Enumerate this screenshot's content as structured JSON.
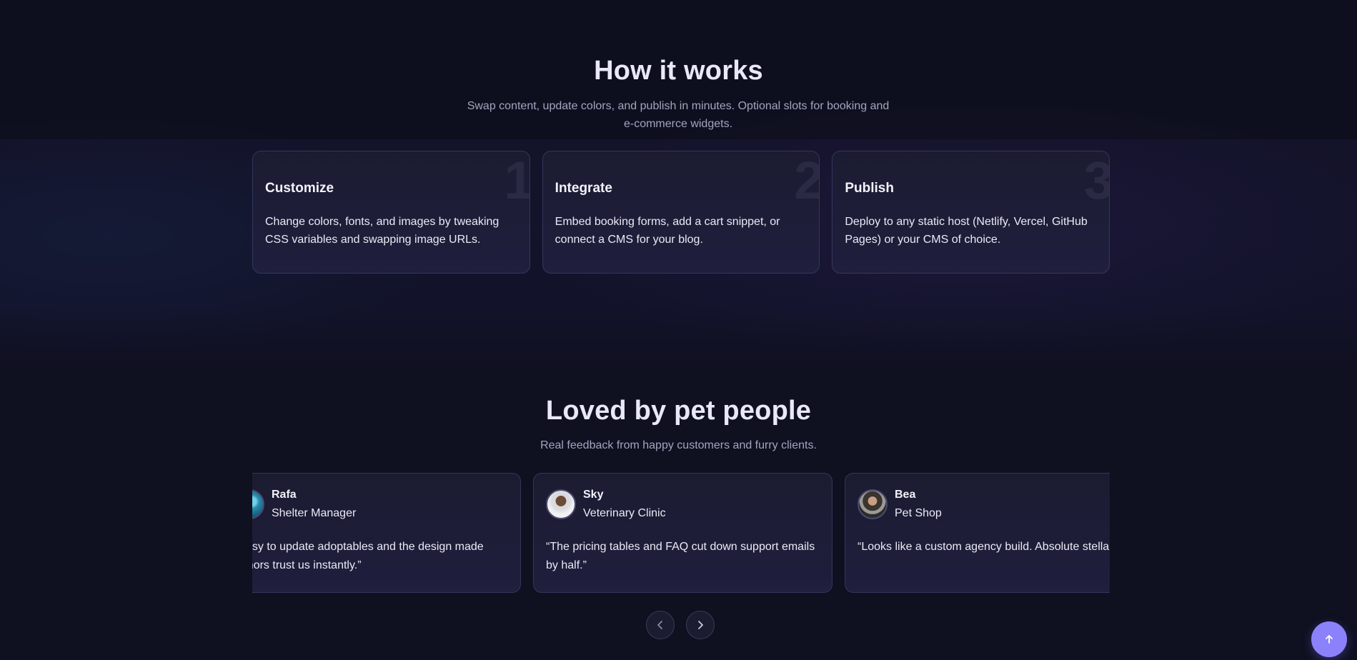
{
  "how_it_works": {
    "title": "How it works",
    "subtitle": "Swap content, update colors, and publish in minutes. Optional slots for booking and e-commerce widgets.",
    "steps": [
      {
        "number": "1",
        "title": "Customize",
        "text": "Change colors, fonts, and images by tweaking CSS variables and swapping image URLs."
      },
      {
        "number": "2",
        "title": "Integrate",
        "text": "Embed booking forms, add a cart snippet, or connect a CMS for your blog."
      },
      {
        "number": "3",
        "title": "Publish",
        "text": "Deploy to any static host (Netlify, Vercel, GitHub Pages) or your CMS of choice."
      }
    ]
  },
  "testimonials": {
    "title": "Loved by pet people",
    "subtitle": "Real feedback from happy customers and furry clients.",
    "items": [
      {
        "name": "Rafa",
        "role": "Shelter Manager",
        "quote": "“Easy to update adoptables and the design made\ndonors trust us instantly.”"
      },
      {
        "name": "Sky",
        "role": "Veterinary Clinic",
        "quote": "“The pricing tables and FAQ cut down support emails\nby half.”"
      },
      {
        "name": "Bea",
        "role": "Pet Shop",
        "quote": "“Looks like a custom agency build. Absolute stellar.”"
      }
    ],
    "prev_icon": "chevron-left-icon",
    "next_icon": "chevron-right-icon"
  },
  "scroll_top": {
    "icon": "arrow-up-icon"
  },
  "colors": {
    "accent": "#8b82fb",
    "background": "#0f1020",
    "card": "#1d1d38"
  }
}
